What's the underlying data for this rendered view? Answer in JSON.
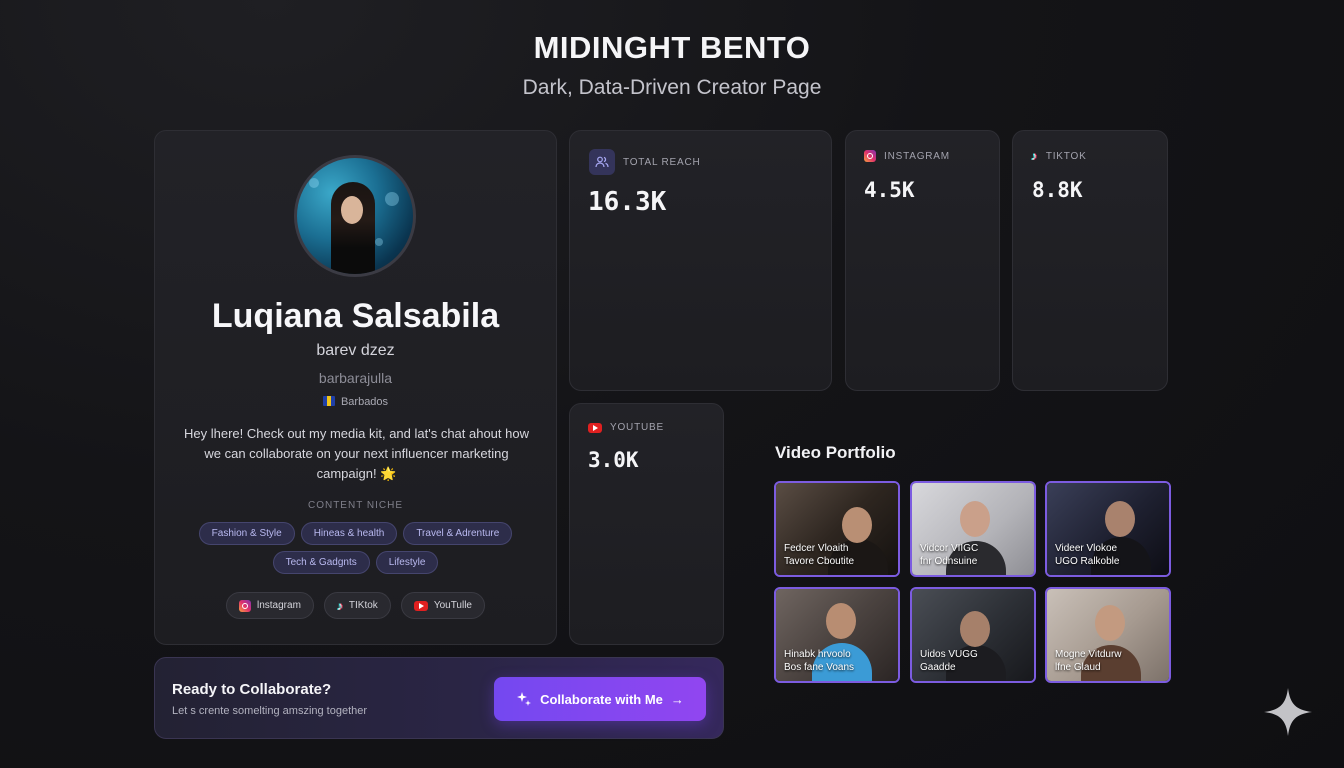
{
  "header": {
    "title": "MIDINGHT BENTO",
    "subtitle": "Dark, Data-Driven Creator Page"
  },
  "profile": {
    "name": "Luqiana Salsabila",
    "handle": "barev dzez",
    "username": "barbarajulla",
    "location": "Barbados",
    "bio": "Hey lhere! Check out my media kit, and lat's chat ahout how we can collaborate on your next influencer marketing campaign! 🌟",
    "niche_title": "CONTENT NICHE",
    "niches_row1": [
      "Fashion & Style",
      "Hineas & health",
      "Travel & Adrenture"
    ],
    "niches_row2": [
      "Tech & Gadgnts",
      "Lifestyle"
    ],
    "socials": [
      "lnstagram",
      "TIKtok",
      "YouTulle"
    ]
  },
  "stats": {
    "reach": {
      "label": "TOTAL REACH",
      "value": "16.3K",
      "icon": "users-icon"
    },
    "instagram": {
      "label": "INSTAGRAM",
      "value": "4.5K",
      "icon": "instagram-icon"
    },
    "tiktok": {
      "label": "TIKTOK",
      "value": "8.8K",
      "icon": "tiktok-icon"
    },
    "youtube": {
      "label": "YOUTUBE",
      "value": "3.0K",
      "icon": "youtube-icon"
    }
  },
  "portfolio": {
    "title": "Video Portfolio",
    "videos": [
      {
        "line1": "Fedcer Vloaith",
        "line2": "Tavore Cboutite"
      },
      {
        "line1": "Vidcor VIIGC",
        "line2": "fnr Odnsuine"
      },
      {
        "line1": "Videer Vlokoe",
        "line2": "UGO Ralkoble"
      },
      {
        "line1": "Hinabk hrvoolo",
        "line2": "Bos fane Voans"
      },
      {
        "line1": "Uidos VUGG",
        "line2": "Gaadde"
      },
      {
        "line1": "Mogne Vitdurw",
        "line2": "lfne Glaud"
      }
    ]
  },
  "cta": {
    "title": "Ready to Collaborate?",
    "subtitle": "Let s crente somelting amszing together",
    "button_label": "Collaborate with Me",
    "accent": "#7c4dff"
  }
}
